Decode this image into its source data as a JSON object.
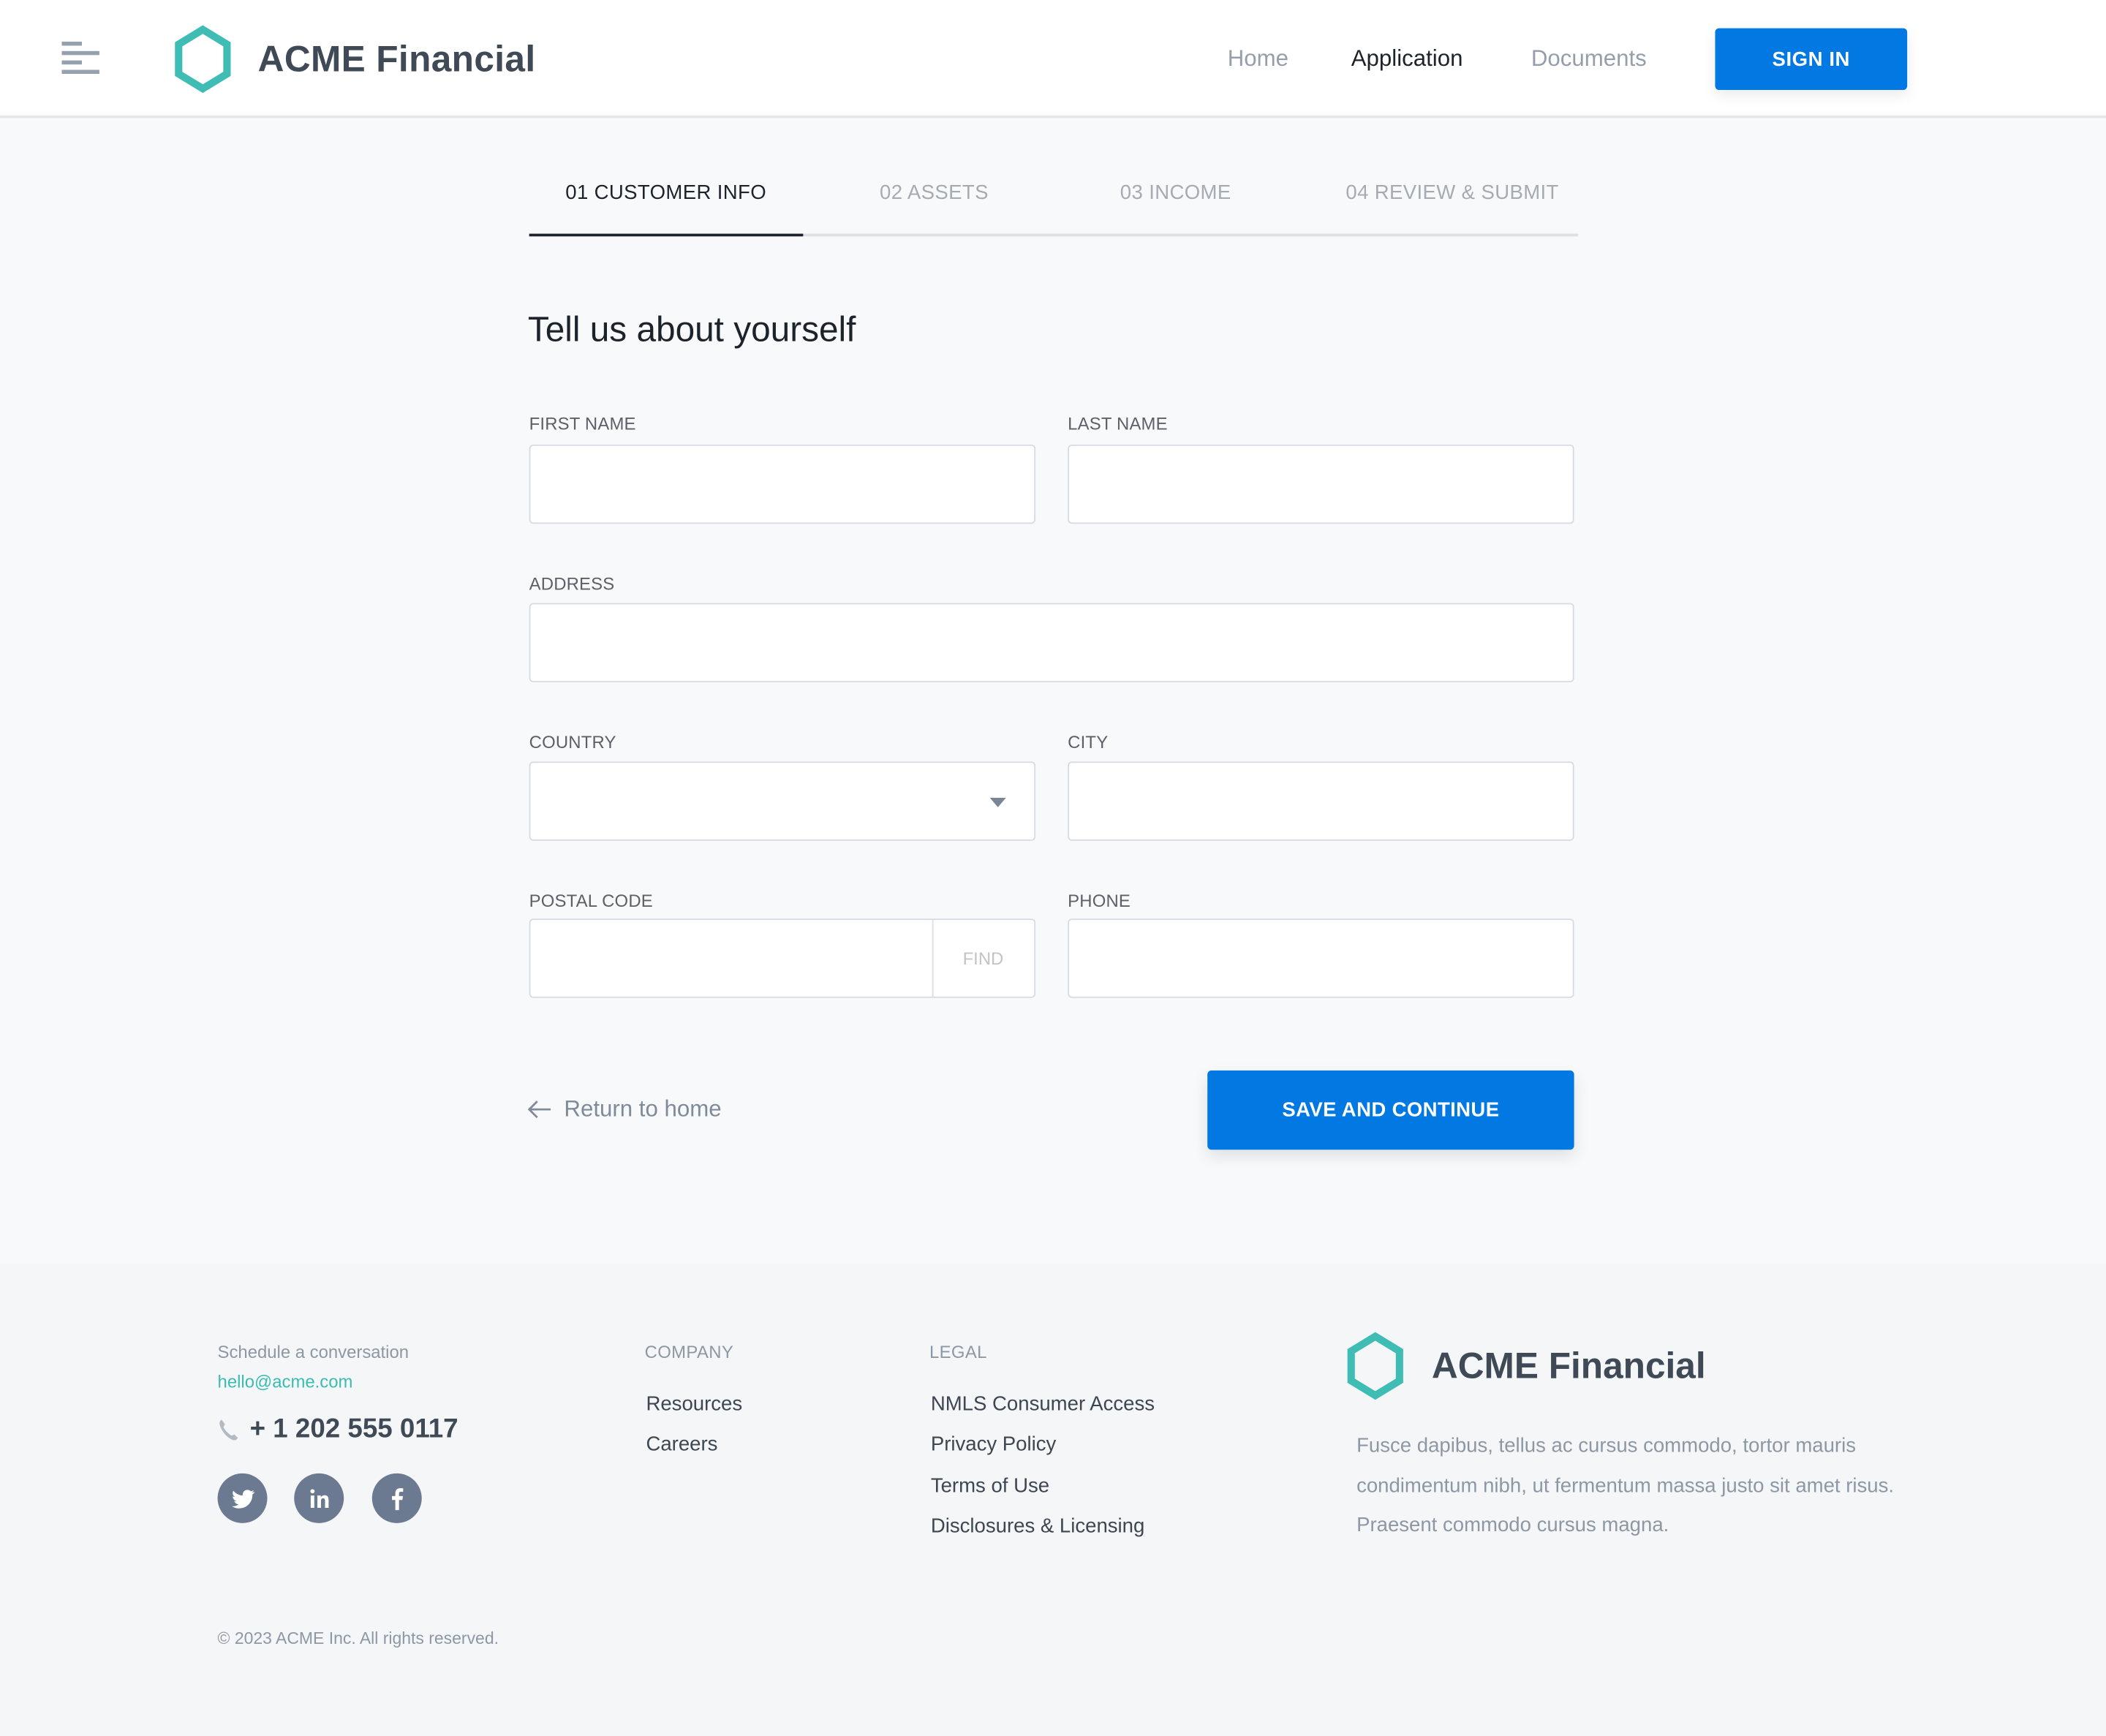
{
  "header": {
    "brand": "ACME Financial",
    "nav": [
      {
        "label": "Home",
        "active": false
      },
      {
        "label": "Application",
        "active": true
      },
      {
        "label": "Documents",
        "active": false
      }
    ],
    "sign_in_label": "SIGN IN"
  },
  "steps": [
    {
      "label": "01 CUSTOMER INFO",
      "active": true
    },
    {
      "label": "02 ASSETS",
      "active": false
    },
    {
      "label": "03 INCOME",
      "active": false
    },
    {
      "label": "04 REVIEW & SUBMIT",
      "active": false
    }
  ],
  "form": {
    "title": "Tell us about yourself",
    "fields": {
      "first_name": {
        "label": "FIRST NAME",
        "value": "",
        "placeholder": ""
      },
      "last_name": {
        "label": "LAST NAME",
        "value": "",
        "placeholder": ""
      },
      "address": {
        "label": "ADDRESS",
        "value": "",
        "placeholder": ""
      },
      "country": {
        "label": "COUNTRY",
        "value": ""
      },
      "city": {
        "label": "CITY",
        "value": "",
        "placeholder": ""
      },
      "postal_code": {
        "label": "POSTAL CODE",
        "value": "",
        "placeholder": "",
        "find_label": "FIND"
      },
      "phone": {
        "label": "PHONE",
        "value": "",
        "placeholder": ""
      }
    },
    "return_label": "Return to home",
    "save_label": "SAVE AND CONTINUE"
  },
  "footer": {
    "schedule_label": "Schedule a conversation",
    "email": "hello@acme.com",
    "phone": "+ 1 202 555 0117",
    "social": [
      "twitter",
      "linkedin",
      "facebook"
    ],
    "company": {
      "heading": "COMPANY",
      "links": [
        "Resources",
        "Careers"
      ]
    },
    "legal": {
      "heading": "LEGAL",
      "links": [
        "NMLS Consumer Access",
        "Privacy Policy",
        "Terms of Use",
        "Disclosures & Licensing"
      ]
    },
    "brand": "ACME Financial",
    "description": "Fusce dapibus, tellus ac cursus commodo, tortor mauris condimentum nibh, ut fermentum massa justo sit amet risus. Praesent commodo cursus magna.",
    "copyright": "© 2023 ACME Inc. All rights reserved."
  },
  "colors": {
    "primary": "#0278e3",
    "brand_teal": "#3fbdb5",
    "text_dark": "#1d232b",
    "text_muted": "#8d98a4"
  }
}
